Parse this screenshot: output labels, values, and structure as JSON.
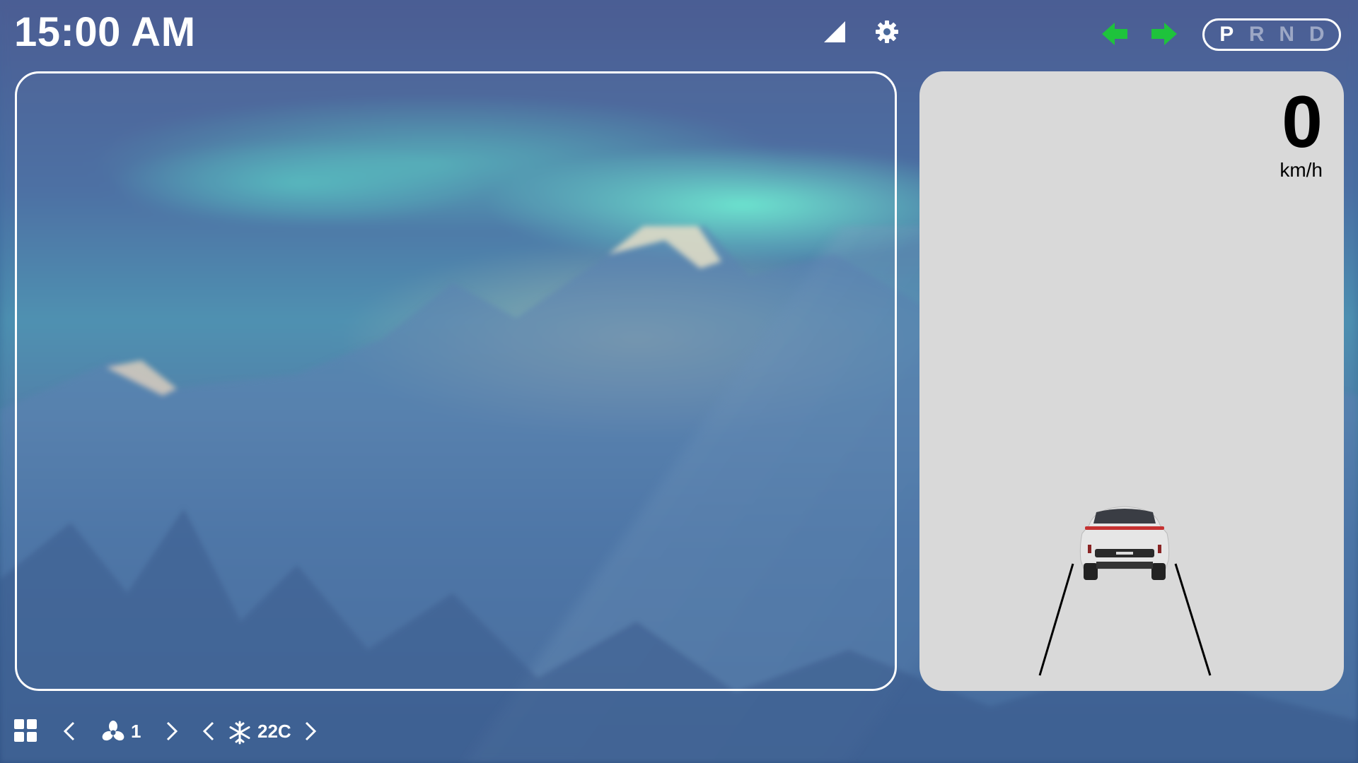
{
  "status_bar": {
    "time": "15:00 AM",
    "gear_selector": [
      "P",
      "R",
      "N",
      "D"
    ],
    "active_gear": "P"
  },
  "speed": {
    "value": "0",
    "unit": "km/h"
  },
  "climate": {
    "fan_level": "1",
    "temperature": "22C"
  },
  "colors": {
    "turn_signal": "#1ec33c",
    "panel_bg": "#d9d9d9"
  },
  "icons": [
    "signal-icon",
    "gear-icon",
    "turn-left-icon",
    "turn-right-icon",
    "apps-icon",
    "fan-icon",
    "snowflake-icon",
    "chevron-left-icon",
    "chevron-right-icon"
  ]
}
